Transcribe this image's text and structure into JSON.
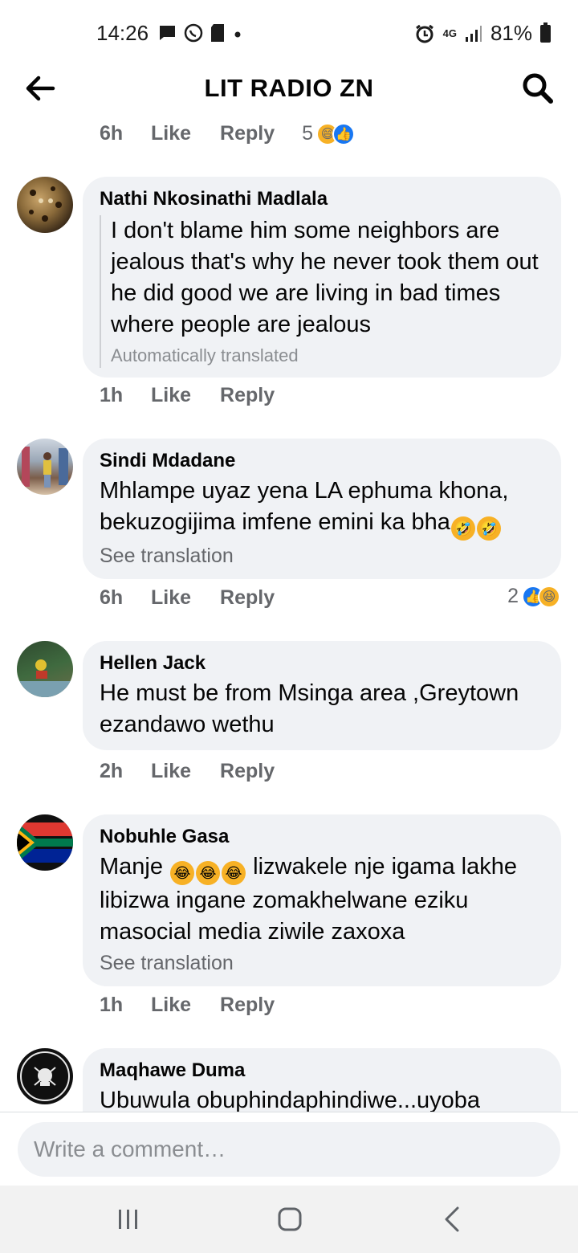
{
  "status_bar": {
    "time": "14:26",
    "battery": "81%",
    "network": "4G"
  },
  "header": {
    "title": "LIT RADIO ZN"
  },
  "top_actions": {
    "time": "6h",
    "like": "Like",
    "reply": "Reply",
    "reaction_count": "5"
  },
  "comments": [
    {
      "author": "Nathi Nkosinathi Madlala",
      "text": "I don't blame him some neighbors are jealous that's why he never took them out he did good we are living in bad times where people are jealous",
      "translation_note": "Automatically translated",
      "time": "1h",
      "like": "Like",
      "reply": "Reply"
    },
    {
      "author": "Sindi Mdadane",
      "text": "Mhlampe uyaz yena LA ephuma khona, bekuzogijima imfene emini ka bha",
      "see_translation": "See translation",
      "time": "6h",
      "like": "Like",
      "reply": "Reply",
      "reaction_count": "2"
    },
    {
      "author": "Hellen Jack",
      "text": "He must be from Msinga area ,Greytown ezandawo wethu",
      "time": "2h",
      "like": "Like",
      "reply": "Reply"
    },
    {
      "author": "Nobuhle Gasa",
      "text_start": "Manje",
      "text_rest": " lizwakele nje igama lakhe libizwa ingane zomakhelwane eziku masocial media ziwile zaxoxa",
      "see_translation": "See translation",
      "time": "1h",
      "like": "Like",
      "reply": "Reply"
    },
    {
      "author": "Maqhawe Duma",
      "text": "Ubuwula obuphindaphindiwe...uyoba"
    }
  ],
  "composer": {
    "placeholder": "Write a comment…"
  }
}
